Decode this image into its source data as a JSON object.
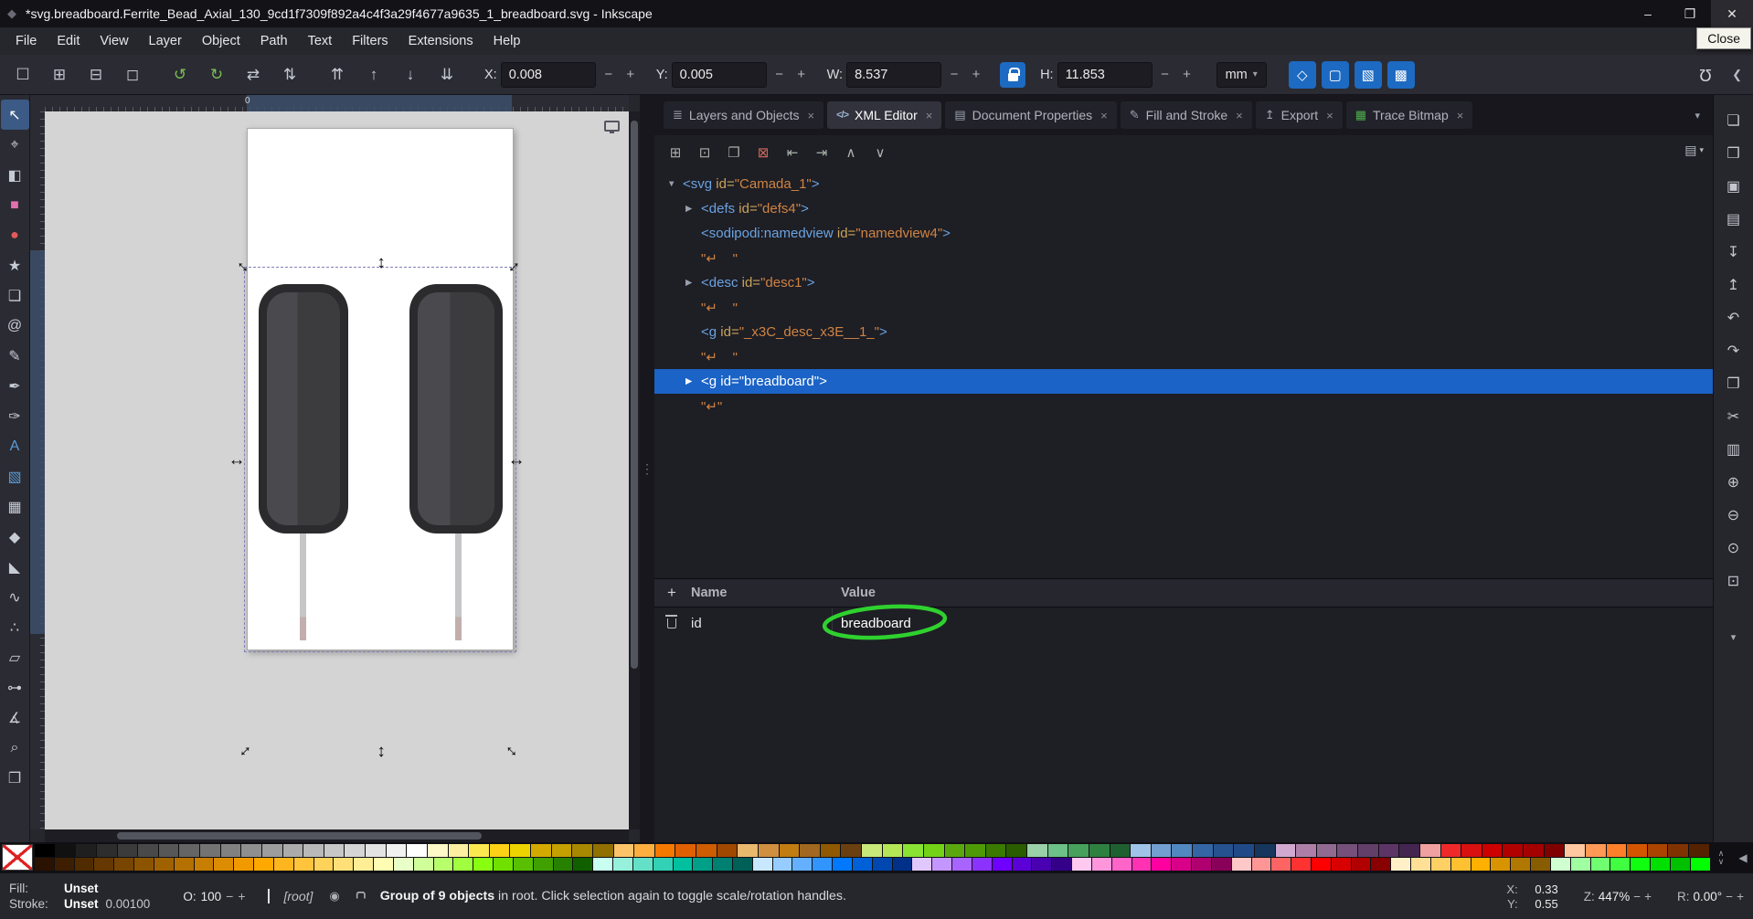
{
  "colors": {
    "titlebar_bg": "#121217",
    "menubar_bg": "#26262d",
    "toolbar_bg": "#2b2b33",
    "panel_bg": "#1e1e25",
    "toolbox_bg": "#2b2b33",
    "canvas_desk": "#d4d4d4",
    "page_white": "#ffffff",
    "accent_blue": "#1d6ac2",
    "selection_row_blue": "#1b63c6",
    "xml_tag": "#6aa3e0",
    "xml_attr": "#c9a35a",
    "xml_value": "#cf8443",
    "annotation_green": "#2fd12f",
    "statusbar_bg": "#26262d",
    "edgebar_bg": "#26262d",
    "ruler_bg": "#2b2b33",
    "ruler_highlight": "#3c4f6b",
    "bead_outer": "#2b2b2e",
    "bead_inner_light": "#4a4a4e",
    "bead_inner_dark": "#3c3c3f",
    "lead": "#c6c6c8",
    "lead_tip": "#c3aeae",
    "scroll_thumb": "#53555e",
    "tab_active_bg": "#32323c",
    "tab_inactive_bg": "#22222a"
  },
  "window": {
    "title": "*svg.breadboard.Ferrite_Bead_Axial_130_9cd1f7309f892a4c4f3a29f4677a9635_1_breadboard.svg - Inkscape",
    "close_tooltip": "Close"
  },
  "icons": {
    "app": "◆",
    "minimize": "–",
    "maximize": "❐",
    "close": "✕",
    "snap": "Ω",
    "collapse_left": "❮",
    "dropdown": "▾",
    "tab_overflow": "▾",
    "tab_close": "×",
    "handle": "↔",
    "ellipsis": "⋮",
    "xml_menu": "▤",
    "add": "+",
    "eye": "◉",
    "palette_up": "∧",
    "palette_down": "∨",
    "palette_left": "◀"
  },
  "menu": {
    "items": [
      "File",
      "Edit",
      "View",
      "Layer",
      "Object",
      "Path",
      "Text",
      "Filters",
      "Extensions",
      "Help"
    ]
  },
  "cmdbar": {
    "icons": [
      "☐",
      "⊞",
      "⊟",
      "◻",
      "↺",
      "↻",
      "⇄",
      "⇅",
      "⇈",
      "↑",
      "↓",
      "⇊"
    ],
    "x_label": "X:",
    "x_value": "0.008",
    "y_label": "Y:",
    "y_value": "0.005",
    "w_label": "W:",
    "w_value": "8.537",
    "h_label": "H:",
    "h_value": "11.853",
    "units": "mm",
    "minus": "−",
    "plus": "+",
    "toggles": [
      "◇",
      "▢",
      "▧",
      "▩"
    ]
  },
  "toolbox": {
    "glyphs": [
      "↖",
      "⌖",
      "◧",
      "■",
      "●",
      "★",
      "❑",
      "@",
      "✎",
      "✒",
      "✑",
      "A",
      "▧",
      "▦",
      "◆",
      "◣",
      "∿",
      "∴",
      "▱",
      "⊶",
      "∡",
      "⌕",
      "❐"
    ]
  },
  "canvas": {
    "ruler_zero": "0"
  },
  "panel": {
    "tabs": [
      {
        "icon": "≣",
        "label": "Layers and Objects"
      },
      {
        "icon": "</>",
        "label": "XML Editor"
      },
      {
        "icon": "▤",
        "label": "Document Properties"
      },
      {
        "icon": "✎",
        "label": "Fill and Stroke"
      },
      {
        "icon": "↥",
        "label": "Export"
      },
      {
        "icon": "▦",
        "label": "Trace Bitmap"
      }
    ]
  },
  "xml": {
    "toolbar": {
      "new_element": "⊞",
      "new_text": "⊡",
      "duplicate": "❐",
      "delete": "⊠",
      "unindent": "⇤",
      "indent": "⇥",
      "up": "∧",
      "down": "∨"
    },
    "tree": [
      {
        "expander": "▼",
        "open": "<svg",
        "attr": " id=",
        "value": "\"Camada_1\"",
        "close": ">"
      },
      {
        "expander": "▶",
        "open": "<defs",
        "attr": " id=",
        "value": "\"defs4\"",
        "close": ">"
      },
      {
        "expander": "",
        "open": "<sodipodi:namedview",
        "attr": " id=",
        "value": "\"namedview4\"",
        "close": ">"
      },
      {
        "expander": "",
        "text": "\"↵    \""
      },
      {
        "expander": "▶",
        "open": "<desc",
        "attr": " id=",
        "value": "\"desc1\"",
        "close": ">"
      },
      {
        "expander": "",
        "text": "\"↵    \""
      },
      {
        "expander": "",
        "open": "<g",
        "attr": " id=",
        "value": "\"_x3C_desc_x3E__1_\"",
        "close": ">"
      },
      {
        "expander": "",
        "text": "\"↵    \""
      },
      {
        "expander": "▶",
        "open": "<g",
        "attr": " id=",
        "value": "\"breadboard\"",
        "close": ">"
      },
      {
        "expander": "",
        "text": "\"↵\""
      }
    ],
    "attrs": {
      "header_name": "Name",
      "header_value": "Value",
      "rows": [
        {
          "name": "id",
          "value": "breadboard"
        }
      ]
    }
  },
  "edgebar": {
    "glyphs": [
      "❏",
      "❒",
      "▣",
      "▤",
      "↧",
      "↥",
      "↶",
      "↷",
      "❐",
      "✂",
      "▥",
      "⊕",
      "⊖",
      "⊙",
      "⊡",
      "▾"
    ]
  },
  "palette": {
    "row1": [
      "#000000",
      "#111111",
      "#1f1f1f",
      "#2d2d2d",
      "#3b3b3b",
      "#494949",
      "#575757",
      "#656565",
      "#737373",
      "#818181",
      "#8f8f8f",
      "#9d9d9d",
      "#ababab",
      "#b9b9b9",
      "#c7c7c7",
      "#d5d5d5",
      "#e3e3e3",
      "#f1f1f1",
      "#ffffff",
      "#fff8c8",
      "#fcf0a0",
      "#fce94f",
      "#fcd116",
      "#edd400",
      "#d4aa00",
      "#c4a000",
      "#a88800",
      "#8f7000",
      "#fcc468",
      "#fcaf3e",
      "#f57900",
      "#e06000",
      "#ce5c00",
      "#a04800",
      "#e9b96e",
      "#d09040",
      "#c17d11",
      "#a06820",
      "#8f5902",
      "#6a4010",
      "#c8e87a",
      "#b5e655",
      "#8ae234",
      "#73d216",
      "#5aa80e",
      "#4e9a06",
      "#3a7a00",
      "#2a5c00",
      "#9ad1a8",
      "#6cc088",
      "#47a05c",
      "#2e8040",
      "#1f6030",
      "#a0c4e8",
      "#729fcf",
      "#5288c0",
      "#3465a4",
      "#26528e",
      "#204a87",
      "#16365c",
      "#d0a8d0",
      "#ad7fa8",
      "#916a92",
      "#75507b",
      "#613f68",
      "#5c3566",
      "#432650",
      "#f0a0a0",
      "#ef2929",
      "#d81010",
      "#cc0000",
      "#b00000",
      "#a40000",
      "#800000",
      "#ffc8a0",
      "#ff9955",
      "#ff7f2a",
      "#d45500",
      "#aa4400",
      "#803300",
      "#552200"
    ],
    "row2": [
      "#2b1100",
      "#3d1e00",
      "#502b00",
      "#643800",
      "#784600",
      "#8c5400",
      "#a06200",
      "#b47000",
      "#c87e00",
      "#dc8c00",
      "#f09a00",
      "#ffa800",
      "#ffb61e",
      "#ffc43c",
      "#ffd25a",
      "#ffe078",
      "#ffee96",
      "#fffcb4",
      "#e8ffc8",
      "#d0ff9a",
      "#b8ff6c",
      "#a0ff3e",
      "#88ff10",
      "#70e000",
      "#58c000",
      "#40a000",
      "#288000",
      "#106000",
      "#c8fff0",
      "#96f0dc",
      "#64e0c8",
      "#32d0b4",
      "#00c0a0",
      "#00a088",
      "#008070",
      "#006058",
      "#c8e8ff",
      "#96ccff",
      "#64b0ff",
      "#3294ff",
      "#0078ff",
      "#0060d8",
      "#0048b0",
      "#003088",
      "#e0c8ff",
      "#c496ff",
      "#a864ff",
      "#8c32ff",
      "#7000ff",
      "#5c00d8",
      "#4800b0",
      "#340088",
      "#ffc8f0",
      "#ff96dc",
      "#ff64c8",
      "#ff32b4",
      "#ff00a0",
      "#d80088",
      "#b00070",
      "#880058",
      "#ffc8c8",
      "#ff9696",
      "#ff6464",
      "#ff3232",
      "#ff0000",
      "#d80000",
      "#b00000",
      "#880000",
      "#fff0c8",
      "#ffe096",
      "#ffd064",
      "#ffc032",
      "#ffb000",
      "#d89400",
      "#b07800",
      "#885c00",
      "#d0ffd0",
      "#a0ffa0",
      "#70ff70",
      "#40ff40",
      "#10ff10",
      "#00e000",
      "#00c000",
      "#00ff00"
    ]
  },
  "status": {
    "fill_label": "Fill:",
    "fill_value": "Unset",
    "stroke_label": "Stroke:",
    "stroke_value": "Unset",
    "stroke_width": "0.00100",
    "opacity_label": "O:",
    "opacity_value": "100",
    "minus": "−",
    "plus": "+",
    "layer_indicator": "[root]",
    "message_bold": "Group of 9 objects",
    "message_rest": " in root. Click selection again to toggle scale/rotation handles.",
    "x_label": "X:",
    "x_value": "0.33",
    "y_label": "Y:",
    "y_value": "0.55",
    "zoom_label": "Z:",
    "zoom_value": "447%",
    "rotation_label": "R:",
    "rotation_value": "0.00°"
  }
}
